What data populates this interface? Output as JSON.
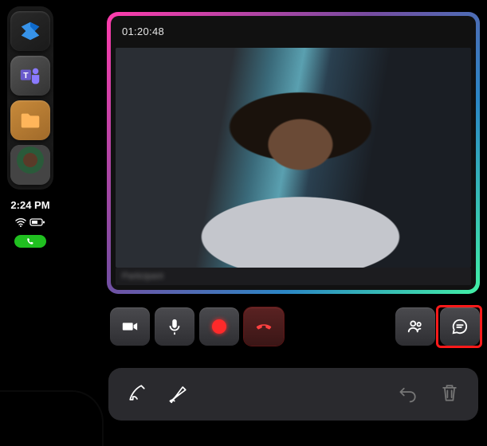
{
  "sidebar": {
    "apps": [
      {
        "name": "power-automate-icon",
        "label": "Power Automate"
      },
      {
        "name": "teams-icon",
        "label": "Microsoft Teams"
      },
      {
        "name": "files-icon",
        "label": "Files"
      },
      {
        "name": "contact-avatar",
        "label": "Contact"
      }
    ],
    "clock": "2:24 PM",
    "battery_icon": "battery-icon",
    "wifi_icon": "wifi-icon",
    "call_active_icon": "phone-icon"
  },
  "video": {
    "timer": "01:20:48",
    "participant_name": "Participant"
  },
  "controls": {
    "camera": "Camera",
    "mic": "Microphone",
    "record": "Record",
    "end_call": "End call",
    "participants": "Participants",
    "chat": "Chat"
  },
  "drawbar": {
    "pen": "Pen",
    "highlighter": "Highlighter",
    "undo": "Undo",
    "delete": "Delete"
  },
  "highlight_target": "chat-button"
}
